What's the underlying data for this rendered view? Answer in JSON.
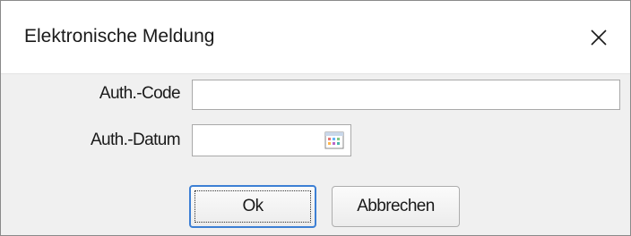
{
  "dialog": {
    "title": "Elektronische Meldung",
    "close_icon": "close-icon"
  },
  "form": {
    "auth_code_label": "Auth.-Code",
    "auth_code_value": "",
    "auth_date_label": "Auth.-Datum",
    "auth_date_value": "",
    "calendar_icon": "calendar-icon"
  },
  "buttons": {
    "ok_label": "Ok",
    "cancel_label": "Abbrechen"
  }
}
